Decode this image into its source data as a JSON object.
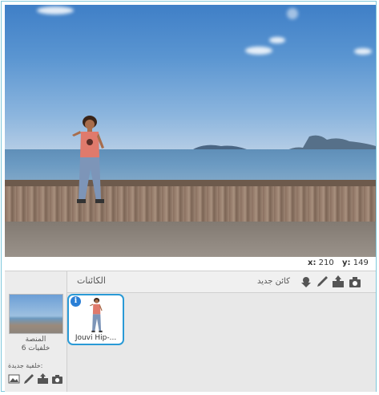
{
  "stage": {
    "background_name": "boardwalk",
    "sprite_costume": "Jouvi Hip-Hop"
  },
  "coords": {
    "x_label": "x:",
    "x_value": "210",
    "y_label": "y:",
    "y_value": "149"
  },
  "sprite_pane": {
    "title": "الكائنات",
    "new_sprite_label": "كائن جديد",
    "tools": [
      "camera-icon",
      "upload-icon",
      "paint-brush-icon",
      "choose-sprite-icon"
    ]
  },
  "stage_column": {
    "name": "المنصة",
    "backdrop_count": "خلفيات 6",
    "new_backdrop_label": "خلفية جديدة:",
    "tools": [
      "landscape-icon",
      "paint-brush-icon",
      "upload-icon",
      "camera-icon"
    ]
  },
  "sprites": [
    {
      "name": "Jouvi Hip-...",
      "selected": true,
      "info": "i"
    }
  ],
  "colors": {
    "frame_border": "#7fc8dc",
    "selection": "#2a9ad6",
    "info_badge": "#2a7fd6"
  }
}
